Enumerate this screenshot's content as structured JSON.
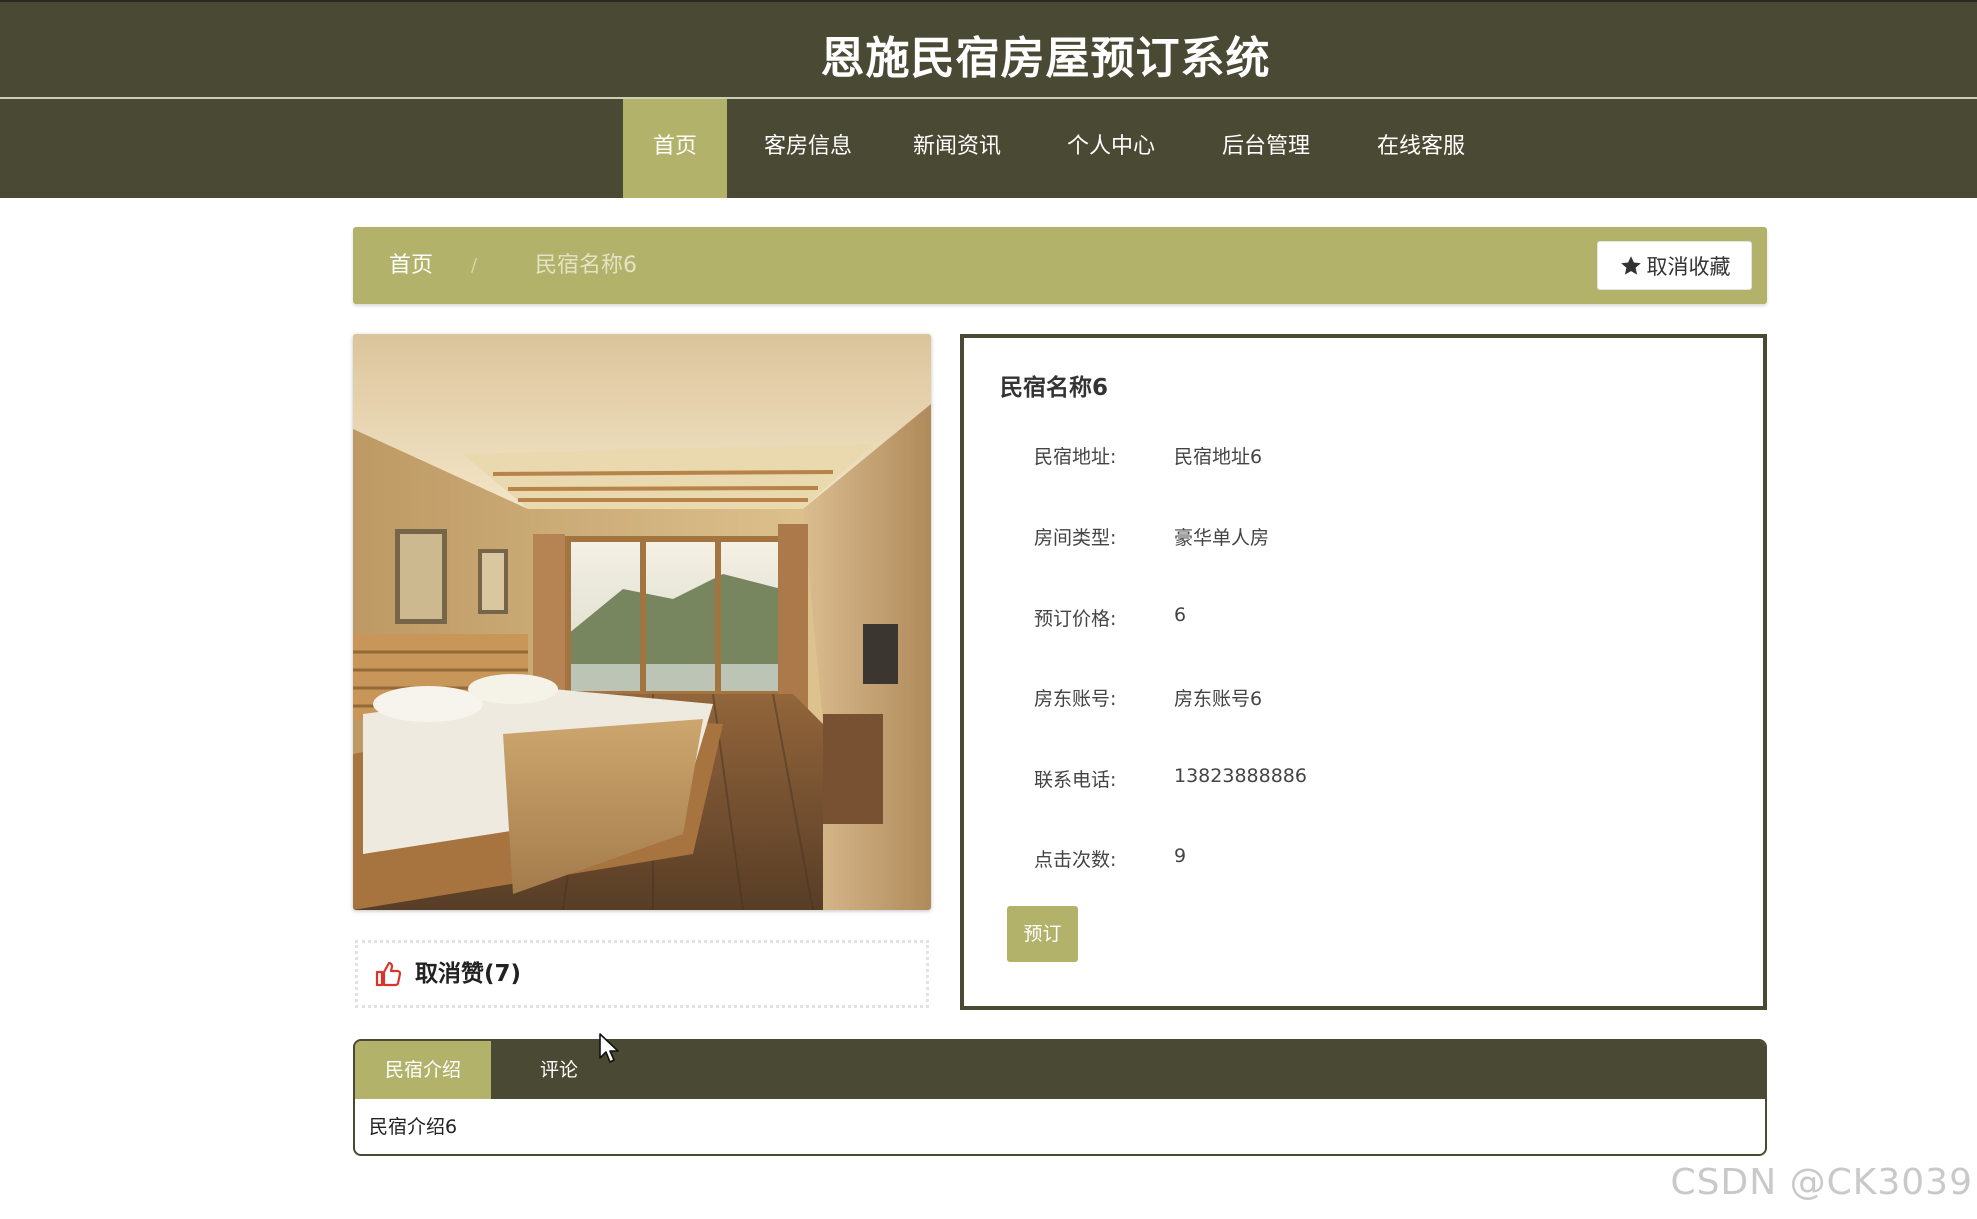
{
  "header": {
    "title": "恩施民宿房屋预订系统"
  },
  "nav": {
    "items": [
      {
        "label": "首页",
        "active": true
      },
      {
        "label": "客房信息",
        "active": false
      },
      {
        "label": "新闻资讯",
        "active": false
      },
      {
        "label": "个人中心",
        "active": false
      },
      {
        "label": "后台管理",
        "active": false
      },
      {
        "label": "在线客服",
        "active": false
      }
    ]
  },
  "breadcrumb": {
    "home": "首页",
    "separator": "/",
    "current": "民宿名称6"
  },
  "favorite_button": {
    "label": "取消收藏",
    "icon": "star-icon"
  },
  "like": {
    "label": "取消赞(7)",
    "icon": "thumbs-up-icon"
  },
  "detail": {
    "name": "民宿名称6",
    "fields": [
      {
        "label": "民宿地址:",
        "value": "民宿地址6"
      },
      {
        "label": "房间类型:",
        "value": "豪华单人房"
      },
      {
        "label": "预订价格:",
        "value": "6"
      },
      {
        "label": "房东账号:",
        "value": "房东账号6"
      },
      {
        "label": "联系电话:",
        "value": "13823888886"
      },
      {
        "label": "点击次数:",
        "value": "9"
      }
    ],
    "book_button": "预订"
  },
  "tabs": {
    "items": [
      {
        "label": "民宿介绍",
        "active": true
      },
      {
        "label": "评论",
        "active": false
      }
    ],
    "content": "民宿介绍6"
  },
  "watermark": "CSDN @CK3039",
  "colors": {
    "header_bg": "#4a4933",
    "accent": "#b3b26a",
    "like_icon": "#d9342b"
  }
}
